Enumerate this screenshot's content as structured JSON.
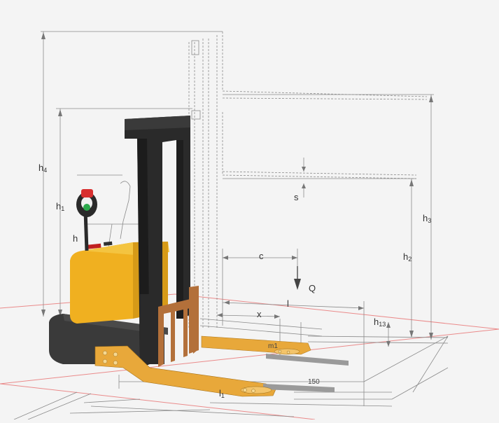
{
  "dimensions": {
    "h4": {
      "base": "h",
      "sub": "4"
    },
    "h1": {
      "base": "h",
      "sub": "1"
    },
    "h3": {
      "base": "h",
      "sub": "3"
    },
    "h2": {
      "base": "h",
      "sub": "2"
    },
    "h13": {
      "base": "h",
      "sub": "13"
    },
    "s": "s",
    "c": "c",
    "Q": "Q",
    "l": "l",
    "x": "x",
    "m1": "m1",
    "l1": {
      "base": "l",
      "sub": "1"
    },
    "h14_partial": "h",
    "fork_width": "150"
  },
  "colors": {
    "body_yellow": "#f0b020",
    "mast_black": "#2a2a2a",
    "fork_orange": "#e8a83a",
    "carriage": "#b3703a",
    "floor_line": "#e05050",
    "drawing_line": "#8a8a8a",
    "handle_red": "#d83030",
    "handle_green": "#2aa84a"
  }
}
